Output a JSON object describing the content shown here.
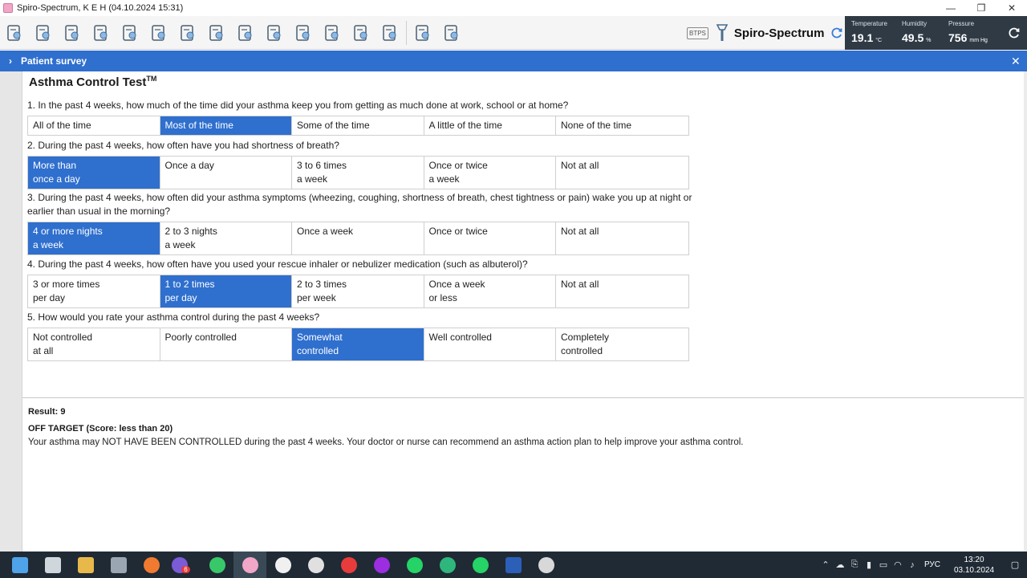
{
  "window": {
    "title": "Spiro-Spectrum, K E H (04.10.2024 15:31)",
    "minimize": "—",
    "restore": "❐",
    "close": "✕"
  },
  "toolbar": {
    "icons": [
      "new-patient-icon",
      "upload-icon",
      "pipette-icon",
      "print-icon",
      "lungs-icon",
      "head-profile-icon",
      "brain-icon",
      "calculator-icon",
      "fan-icon",
      "document-icon",
      "report-icon",
      "chart-icon",
      "import-icon",
      "export-icon",
      "settings-icon",
      "info-icon"
    ],
    "btps": "BTPS",
    "brand": "Spiro-Spectrum"
  },
  "environment": {
    "temperature_label": "Temperature",
    "temperature_value": "19.1",
    "temperature_unit": "°C",
    "humidity_label": "Humidity",
    "humidity_value": "49.5",
    "humidity_unit": "%",
    "pressure_label": "Pressure",
    "pressure_value": "756",
    "pressure_unit": "mm Hg"
  },
  "panel": {
    "chevron": "›",
    "title": "Patient survey",
    "close": "✕"
  },
  "survey": {
    "title": "Asthma Control Test",
    "title_mark": "TM",
    "questions": [
      {
        "text": "1. In the past 4 weeks, how much of the time did your asthma keep you from getting as much done at work, school or at home?",
        "options": [
          "All of the time",
          "Most of the time",
          "Some of the time",
          "A little of the time",
          "None of the time"
        ],
        "selected": 1
      },
      {
        "text": "2. During the past 4 weeks, how often have you had shortness of breath?",
        "options": [
          "More than\nonce a day",
          "Once a day",
          "3 to 6 times\na week",
          "Once or twice\na week",
          "Not at all"
        ],
        "selected": 0
      },
      {
        "text": "3. During the past 4 weeks, how often did your asthma symptoms (wheezing, coughing, shortness of breath, chest tightness or pain) wake you up at night or earlier than usual in the morning?",
        "options": [
          "4 or more nights\na week",
          "2 to 3 nights\na week",
          "Once a week",
          "Once or twice",
          "Not at all"
        ],
        "selected": 0
      },
      {
        "text": "4. During the past 4 weeks, how often have you used your rescue inhaler or nebulizer medication (such as albuterol)?",
        "options": [
          "3 or more times\nper day",
          "1 to 2 times\nper day",
          "2 to 3 times\nper week",
          "Once a week\nor less",
          "Not at all"
        ],
        "selected": 1
      },
      {
        "text": "5. How would you rate your asthma control during the past 4 weeks?",
        "options": [
          "Not controlled\nat all",
          "Poorly controlled",
          "Somewhat\ncontrolled",
          "Well controlled",
          "Completely\ncontrolled"
        ],
        "selected": 2
      }
    ]
  },
  "result": {
    "score_line": "Result: 9",
    "verdict": "OFF TARGET (Score: less than 20)",
    "description": "Your asthma may NOT HAVE BEEN CONTROLLED during the past 4 weeks. Your doctor or nurse can recommend an asthma action plan to help improve your asthma control."
  },
  "taskbar": {
    "apps": [
      {
        "name": "windows-start-icon",
        "color": "#4fa3e8"
      },
      {
        "name": "task-view-icon",
        "color": "#cfd6dc"
      },
      {
        "name": "file-explorer-icon",
        "color": "#e8b94a"
      },
      {
        "name": "calendar-icon",
        "color": "#9aa7b3"
      },
      {
        "name": "drop-app-icon",
        "color": "#f07a30"
      },
      {
        "name": "viber-icon",
        "color": "#7b5bd6",
        "badge": "6"
      },
      {
        "name": "clover-app-icon",
        "color": "#38c86a"
      },
      {
        "name": "spiro-spectrum-icon",
        "color": "#f2a6c8"
      },
      {
        "name": "yandex-browser-icon",
        "color": "#f0f0f0"
      },
      {
        "name": "media-app-icon",
        "color": "#e0e0e0"
      },
      {
        "name": "yandex-icon",
        "color": "#e83b3b"
      },
      {
        "name": "purple-app-icon",
        "color": "#9a2ee0"
      },
      {
        "name": "whatsapp-icon",
        "color": "#25d366"
      },
      {
        "name": "green-app-icon",
        "color": "#2fb67c"
      },
      {
        "name": "whatsapp-business-icon",
        "color": "#25d366"
      },
      {
        "name": "word-icon",
        "color": "#2b5fb8"
      },
      {
        "name": "settings-icon",
        "color": "#d8d8d8"
      }
    ],
    "viber_badge": "6",
    "language": "РУС",
    "time": "13:20",
    "date": "03.10.2024"
  }
}
